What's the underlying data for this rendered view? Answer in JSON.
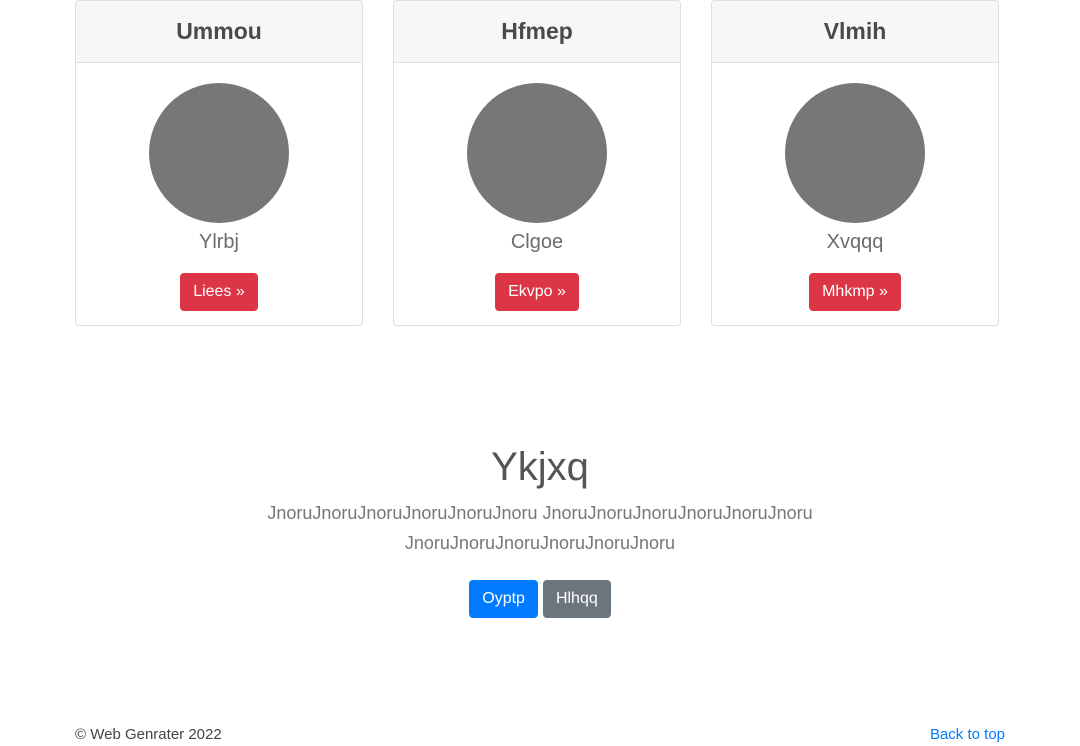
{
  "cards": [
    {
      "title": "Ummou",
      "name": "Ylrbj",
      "button": "Liees »"
    },
    {
      "title": "Hfmep",
      "name": "Clgoe",
      "button": "Ekvpo »"
    },
    {
      "title": "Vlmih",
      "name": "Xvqqq",
      "button": "Mhkmp »"
    }
  ],
  "hero": {
    "title": "Ykjxq",
    "text": "JnoruJnoruJnoruJnoruJnoruJnoru JnoruJnoruJnoruJnoruJnoruJnoru JnoruJnoruJnoruJnoruJnoruJnoru",
    "primary_button": "Oyptp",
    "secondary_button": "Hlhqq"
  },
  "footer": {
    "copyright": "© Web Genrater 2022",
    "back_to_top": "Back to top"
  },
  "colors": {
    "danger": "#dc3545",
    "primary": "#007bff",
    "secondary": "#6c757d",
    "avatar": "#777777"
  }
}
